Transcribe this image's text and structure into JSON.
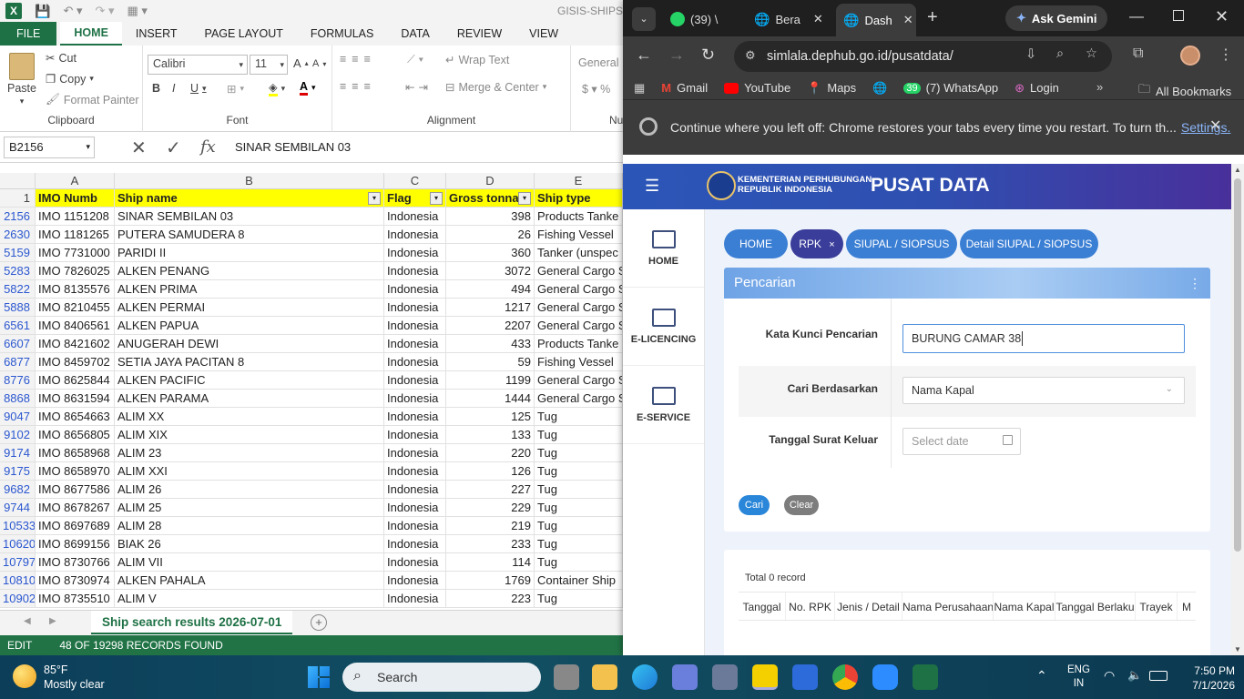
{
  "excel": {
    "title": "GISIS-SHIPS-S",
    "ribbon_tabs": [
      "FILE",
      "HOME",
      "INSERT",
      "PAGE LAYOUT",
      "FORMULAS",
      "DATA",
      "REVIEW",
      "VIEW"
    ],
    "clipboard": {
      "paste": "Paste",
      "cut": "Cut",
      "copy": "Copy",
      "format_painter": "Format Painter",
      "label": "Clipboard"
    },
    "font": {
      "name": "Calibri",
      "size": "11",
      "label": "Font"
    },
    "alignment": {
      "wrap": "Wrap Text",
      "merge": "Merge & Center",
      "label": "Alignment"
    },
    "number": {
      "format": "General",
      "label": "Nu"
    },
    "name_box": "B2156",
    "formula": "SINAR SEMBILAN 03",
    "columns": [
      "A",
      "B",
      "C",
      "D",
      "E"
    ],
    "header_row": {
      "rn": "1",
      "a": "IMO Numb",
      "b": "Ship name",
      "c": "Flag",
      "d": "Gross tonna",
      "e": "Ship type"
    },
    "rows": [
      {
        "rn": "2156",
        "a": "IMO 1151208",
        "b": "SINAR SEMBILAN 03",
        "c": "Indonesia",
        "d": "398",
        "e": "Products Tanke"
      },
      {
        "rn": "2630",
        "a": "IMO 1181265",
        "b": "PUTERA SAMUDERA 8",
        "c": "Indonesia",
        "d": "26",
        "e": "Fishing Vessel"
      },
      {
        "rn": "5159",
        "a": "IMO 7731000",
        "b": "PARIDI II",
        "c": "Indonesia",
        "d": "360",
        "e": "Tanker (unspec"
      },
      {
        "rn": "5283",
        "a": "IMO 7826025",
        "b": "ALKEN PENANG",
        "c": "Indonesia",
        "d": "3072",
        "e": "General Cargo S"
      },
      {
        "rn": "5822",
        "a": "IMO 8135576",
        "b": "ALKEN PRIMA",
        "c": "Indonesia",
        "d": "494",
        "e": "General Cargo S"
      },
      {
        "rn": "5888",
        "a": "IMO 8210455",
        "b": "ALKEN PERMAI",
        "c": "Indonesia",
        "d": "1217",
        "e": "General Cargo S"
      },
      {
        "rn": "6561",
        "a": "IMO 8406561",
        "b": "ALKEN PAPUA",
        "c": "Indonesia",
        "d": "2207",
        "e": "General Cargo S"
      },
      {
        "rn": "6607",
        "a": "IMO 8421602",
        "b": "ANUGERAH DEWI",
        "c": "Indonesia",
        "d": "433",
        "e": "Products Tanke"
      },
      {
        "rn": "6877",
        "a": "IMO 8459702",
        "b": "SETIA JAYA PACITAN 8",
        "c": "Indonesia",
        "d": "59",
        "e": "Fishing Vessel"
      },
      {
        "rn": "8776",
        "a": "IMO 8625844",
        "b": "ALKEN PACIFIC",
        "c": "Indonesia",
        "d": "1199",
        "e": "General Cargo S"
      },
      {
        "rn": "8868",
        "a": "IMO 8631594",
        "b": "ALKEN PARAMA",
        "c": "Indonesia",
        "d": "1444",
        "e": "General Cargo S"
      },
      {
        "rn": "9047",
        "a": "IMO 8654663",
        "b": "ALIM XX",
        "c": "Indonesia",
        "d": "125",
        "e": "Tug"
      },
      {
        "rn": "9102",
        "a": "IMO 8656805",
        "b": "ALIM XIX",
        "c": "Indonesia",
        "d": "133",
        "e": "Tug"
      },
      {
        "rn": "9174",
        "a": "IMO 8658968",
        "b": "ALIM 23",
        "c": "Indonesia",
        "d": "220",
        "e": "Tug"
      },
      {
        "rn": "9175",
        "a": "IMO 8658970",
        "b": "ALIM XXI",
        "c": "Indonesia",
        "d": "126",
        "e": "Tug"
      },
      {
        "rn": "9682",
        "a": "IMO 8677586",
        "b": "ALIM 26",
        "c": "Indonesia",
        "d": "227",
        "e": "Tug"
      },
      {
        "rn": "9744",
        "a": "IMO 8678267",
        "b": "ALIM 25",
        "c": "Indonesia",
        "d": "229",
        "e": "Tug"
      },
      {
        "rn": "10533",
        "a": "IMO 8697689",
        "b": "ALIM 28",
        "c": "Indonesia",
        "d": "219",
        "e": "Tug"
      },
      {
        "rn": "10620",
        "a": "IMO 8699156",
        "b": "BIAK 26",
        "c": "Indonesia",
        "d": "233",
        "e": "Tug"
      },
      {
        "rn": "10797",
        "a": "IMO 8730766",
        "b": "ALIM VII",
        "c": "Indonesia",
        "d": "114",
        "e": "Tug"
      },
      {
        "rn": "10810",
        "a": "IMO 8730974",
        "b": "ALKEN PAHALA",
        "c": "Indonesia",
        "d": "1769",
        "e": "Container Ship"
      },
      {
        "rn": "10902",
        "a": "IMO 8735510",
        "b": "ALIM V",
        "c": "Indonesia",
        "d": "223",
        "e": "Tug"
      }
    ],
    "sheet_tab": "Ship search results 2026-07-01",
    "status_mode": "EDIT",
    "status_text": "48 OF 19298 RECORDS FOUND"
  },
  "chrome": {
    "tabs": [
      {
        "label": "(39) \\"
      },
      {
        "label": "Bera"
      },
      {
        "label": "Dash"
      }
    ],
    "ask_gemini": "Ask Gemini",
    "url": "simlala.dephub.go.id/pusatdata/",
    "bookmarks": [
      "Gmail",
      "YouTube",
      "Maps",
      "(7) WhatsApp",
      "Login"
    ],
    "whatsapp_badge": "39",
    "all_bookmarks": "All Bookmarks",
    "infobar_text": "Continue where you left off: Chrome restores your tabs every time you restart. To turn th...",
    "infobar_link": "Settings."
  },
  "site": {
    "logo_line1": "KEMENTERIAN PERHUBUNGAN",
    "logo_line2": "REPUBLIK INDONESIA",
    "title": "PUSAT DATA",
    "nav": [
      {
        "label": "HOME"
      },
      {
        "label": "E-LICENCING"
      },
      {
        "label": "E-SERVICE"
      }
    ],
    "breadcrumbs": [
      "HOME",
      "RPK",
      "SIUPAL / SIOPSUS",
      "Detail SIUPAL / SIOPSUS"
    ],
    "breadcrumb_close": "×",
    "card_title": "Pencarian",
    "keyword_label": "Kata Kunci Pencarian",
    "keyword_value": "BURUNG CAMAR 38",
    "searchby_label": "Cari Berdasarkan",
    "searchby_value": "Nama Kapal",
    "date_label": "Tanggal Surat Keluar",
    "date_placeholder": "Select date",
    "btn_search": "Cari",
    "btn_clear": "Clear",
    "total": "Total 0 record",
    "table_headers": [
      "Tanggal",
      "No. RPK",
      "Jenis / Detail",
      "Nama Perusahaan",
      "Nama Kapal",
      "Tanggal Berlaku",
      "Trayek",
      "M"
    ]
  },
  "taskbar": {
    "weather_temp": "85°F",
    "weather_desc": "Mostly clear",
    "search_placeholder": "Search",
    "lang1": "ENG",
    "lang2": "IN",
    "time": "7:50 PM",
    "date": "7/1/2026"
  },
  "colors": {
    "excel_green": "#217346",
    "header_yellow": "#ffff00",
    "site_blue": "#3b7fd4",
    "chrome_dark": "#3c3c3c"
  }
}
